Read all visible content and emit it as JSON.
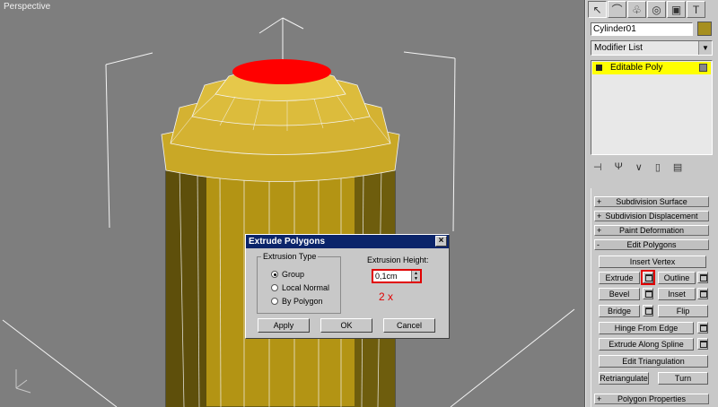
{
  "viewport": {
    "label": "Perspective",
    "colors": {
      "background": "#7e7e7e",
      "mesh": "#c9a826",
      "mesh_dark": "#3a3208",
      "selected_face": "#ff0000",
      "bbox": "#ffffff"
    }
  },
  "panel": {
    "tab_icons": [
      "pointer-icon",
      "curve-icon",
      "hierarchy-icon",
      "motion-icon",
      "display-icon",
      "utilities-icon"
    ],
    "object_name": "Cylinder01",
    "object_color": "#a68f1f",
    "modifier_list": "Modifier List",
    "stack": {
      "item": "Editable Poly"
    },
    "stack_tools": [
      "pin-stack-icon",
      "show-end-result-icon",
      "make-unique-icon",
      "remove-modifier-icon",
      "configure-sets-icon"
    ]
  },
  "rollouts": {
    "subdivision_surface": "Subdivision Surface",
    "subdivision_displacement": "Subdivision Displacement",
    "paint_deformation": "Paint Deformation",
    "edit_polygons": "Edit Polygons",
    "polygon_properties": "Polygon Properties",
    "pm_plus": "+",
    "pm_minus": "-"
  },
  "edit_polygons": {
    "insert_vertex": "Insert Vertex",
    "extrude": "Extrude",
    "outline": "Outline",
    "bevel": "Bevel",
    "inset": "Inset",
    "bridge": "Bridge",
    "flip": "Flip",
    "hinge_from_edge": "Hinge From Edge",
    "extrude_along_spline": "Extrude Along Spline",
    "edit_triangulation": "Edit Triangulation",
    "retriangulate": "Retriangulate",
    "turn": "Turn"
  },
  "dialog": {
    "title": "Extrude Polygons",
    "close": "×",
    "group_label": "Extrusion Type",
    "options": [
      "Group",
      "Local Normal",
      "By Polygon"
    ],
    "selected_option": "Group",
    "height_label": "Extrusion Height:",
    "height_value": "0,1cm",
    "annotation": "2 x",
    "buttons": {
      "apply": "Apply",
      "ok": "OK",
      "cancel": "Cancel"
    }
  }
}
